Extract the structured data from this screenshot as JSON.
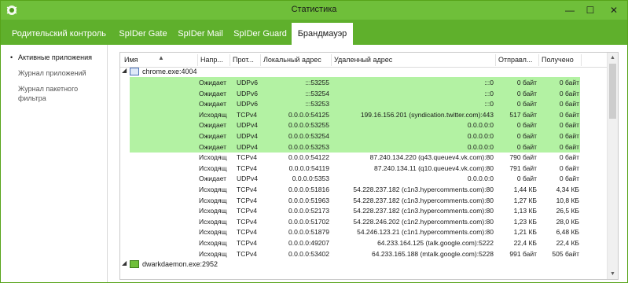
{
  "window": {
    "title": "Статистика",
    "minimize_label": "—",
    "maximize_label": "☐",
    "close_label": "✕"
  },
  "tabs": [
    {
      "label": "Родительский контроль"
    },
    {
      "label": "SpIDer Gate"
    },
    {
      "label": "SpIDer Mail"
    },
    {
      "label": "SpIDer Guard"
    },
    {
      "label": "Брандмауэр",
      "active": true
    }
  ],
  "sidebar": {
    "items": [
      {
        "label": "Активные приложения",
        "active": true
      },
      {
        "label": "Журнал приложений"
      },
      {
        "label": "Журнал пакетного фильтра"
      }
    ]
  },
  "table": {
    "columns": [
      "Имя",
      "Напр...",
      "Прот...",
      "Локальный адрес",
      "Удаленный адрес",
      "Отправл...",
      "Получено"
    ],
    "groups": [
      {
        "name": "chrome.exe:4004",
        "icon": "browser-window-icon"
      },
      {
        "name": "dwarkdaemon.exe:2952",
        "icon": "drweb-app-icon"
      }
    ],
    "rows": [
      {
        "dir": "Ожидает",
        "proto": "UDPv6",
        "local": ":::53255",
        "remote": ":::0",
        "sent": "0 байт",
        "recv": "0 байт",
        "highlight": true
      },
      {
        "dir": "Ожидает",
        "proto": "UDPv6",
        "local": ":::53254",
        "remote": ":::0",
        "sent": "0 байт",
        "recv": "0 байт",
        "highlight": true
      },
      {
        "dir": "Ожидает",
        "proto": "UDPv6",
        "local": ":::53253",
        "remote": ":::0",
        "sent": "0 байт",
        "recv": "0 байт",
        "highlight": true
      },
      {
        "dir": "Исходящ",
        "proto": "TCPv4",
        "local": "0.0.0.0:54125",
        "remote": "199.16.156.201 (syndication.twitter.com):443",
        "sent": "517 байт",
        "recv": "0 байт",
        "highlight": true
      },
      {
        "dir": "Ожидает",
        "proto": "UDPv4",
        "local": "0.0.0.0:53255",
        "remote": "0.0.0.0:0",
        "sent": "0 байт",
        "recv": "0 байт",
        "highlight": true
      },
      {
        "dir": "Ожидает",
        "proto": "UDPv4",
        "local": "0.0.0.0:53254",
        "remote": "0.0.0.0:0",
        "sent": "0 байт",
        "recv": "0 байт",
        "highlight": true
      },
      {
        "dir": "Ожидает",
        "proto": "UDPv4",
        "local": "0.0.0.0:53253",
        "remote": "0.0.0.0:0",
        "sent": "0 байт",
        "recv": "0 байт",
        "highlight": true
      },
      {
        "dir": "Исходящ",
        "proto": "TCPv4",
        "local": "0.0.0.0:54122",
        "remote": "87.240.134.220 (q43.queuev4.vk.com):80",
        "sent": "790 байт",
        "recv": "0 байт",
        "highlight": false
      },
      {
        "dir": "Исходящ",
        "proto": "TCPv4",
        "local": "0.0.0.0:54119",
        "remote": "87.240.134.11 (q10.queuev4.vk.com):80",
        "sent": "791 байт",
        "recv": "0 байт",
        "highlight": false
      },
      {
        "dir": "Ожидает",
        "proto": "UDPv4",
        "local": "0.0.0.0:5353",
        "remote": "0.0.0.0:0",
        "sent": "0 байт",
        "recv": "0 байт",
        "highlight": false
      },
      {
        "dir": "Исходящ",
        "proto": "TCPv4",
        "local": "0.0.0.0:51816",
        "remote": "54.228.237.182 (c1n3.hypercomments.com):80",
        "sent": "1,44 КБ",
        "recv": "4,34 КБ",
        "highlight": false
      },
      {
        "dir": "Исходящ",
        "proto": "TCPv4",
        "local": "0.0.0.0:51963",
        "remote": "54.228.237.182 (c1n3.hypercomments.com):80",
        "sent": "1,27 КБ",
        "recv": "10,8 КБ",
        "highlight": false
      },
      {
        "dir": "Исходящ",
        "proto": "TCPv4",
        "local": "0.0.0.0:52173",
        "remote": "54.228.237.182 (c1n3.hypercomments.com):80",
        "sent": "1,13 КБ",
        "recv": "26,5 КБ",
        "highlight": false
      },
      {
        "dir": "Исходящ",
        "proto": "TCPv4",
        "local": "0.0.0.0:51702",
        "remote": "54.228.246.202 (c1n2.hypercomments.com):80",
        "sent": "1,23 КБ",
        "recv": "28,0 КБ",
        "highlight": false
      },
      {
        "dir": "Исходящ",
        "proto": "TCPv4",
        "local": "0.0.0.0:51879",
        "remote": "54.246.123.21 (c1n1.hypercomments.com):80",
        "sent": "1,21 КБ",
        "recv": "6,48 КБ",
        "highlight": false
      },
      {
        "dir": "Исходящ",
        "proto": "TCPv4",
        "local": "0.0.0.0:49207",
        "remote": "64.233.164.125 (talk.google.com):5222",
        "sent": "22,4 КБ",
        "recv": "22,4 КБ",
        "highlight": false
      },
      {
        "dir": "Исходящ",
        "proto": "TCPv4",
        "local": "0.0.0.0:53402",
        "remote": "64.233.165.188 (mtalk.google.com):5228",
        "sent": "991 байт",
        "recv": "505 байт",
        "highlight": false
      }
    ]
  }
}
